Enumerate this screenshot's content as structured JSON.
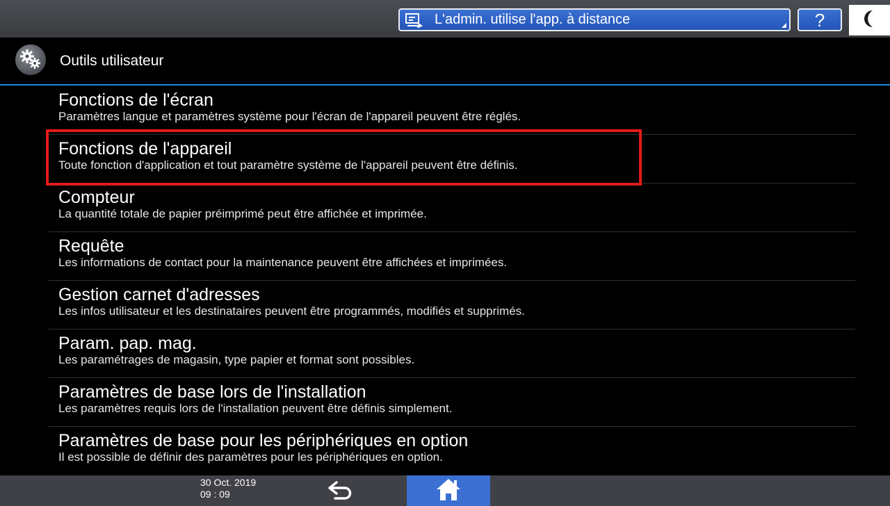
{
  "topbar": {
    "remote_banner": {
      "icon": "remote-operation-icon",
      "text": "L'admin. utilise l'app. à distance"
    },
    "help_label": "?",
    "sleep_icon": "moon-icon"
  },
  "header": {
    "icon": "gears-icon",
    "title": "Outils utilisateur"
  },
  "menu": {
    "items": [
      {
        "title": "Fonctions de l'écran",
        "description": "Paramètres langue et paramètres système pour l'écran de l'appareil peuvent être réglés."
      },
      {
        "title": "Fonctions de l'appareil",
        "description": "Toute fonction d'application et tout paramètre système de l'appareil peuvent être définis.",
        "highlighted": true
      },
      {
        "title": "Compteur",
        "description": "La quantité totale de papier préimprimé peut être affichée et imprimée."
      },
      {
        "title": "Requête",
        "description": "Les informations de contact pour la maintenance peuvent être affichées et imprimées."
      },
      {
        "title": "Gestion carnet d'adresses",
        "description": "Les infos utilisateur et les destinataires peuvent être programmés, modifiés et supprimés."
      },
      {
        "title": "Param. pap. mag.",
        "description": "Les paramétrages de magasin, type papier et format sont possibles."
      },
      {
        "title": "Paramètres de base lors de l'installation",
        "description": "Les paramètres requis lors de l'installation peuvent être définis simplement."
      },
      {
        "title": "Paramètres de base pour les périphériques en option",
        "description": "Il est possible de définir des paramètres pour les périphériques en option."
      }
    ]
  },
  "footer": {
    "date": "30 Oct. 2019",
    "time": "09 : 09",
    "back_icon": "back-arrow-icon",
    "home_icon": "home-icon"
  },
  "colors": {
    "accent_blue": "#3b6fd2",
    "title_line": "#1f8ae0",
    "highlight_red": "#e21b1b",
    "bar_gray": "#3f4146"
  }
}
